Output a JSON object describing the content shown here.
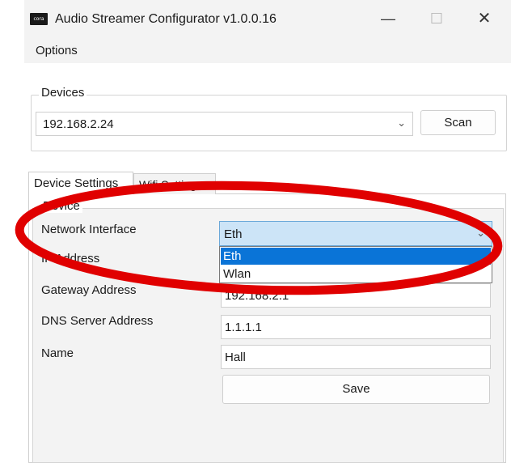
{
  "window": {
    "icon_text": "cora",
    "title": "Audio Streamer Configurator v1.0.0.16",
    "minimize_glyph": "—",
    "maximize_glyph": "☐",
    "close_glyph": "✕"
  },
  "menu": {
    "options_label": "Options"
  },
  "devices": {
    "legend": "Devices",
    "selected": "192.168.2.24",
    "chevron": "⌄",
    "scan_label": "Scan"
  },
  "tabs": [
    {
      "label": "Device Settings",
      "active": true
    },
    {
      "label": "Wifi Settings",
      "active": false
    }
  ],
  "device_settings": {
    "legend": "Device",
    "network_interface_label": "Network Interface",
    "network_interface_value": "Eth",
    "network_interface_options": [
      "Eth",
      "Wlan"
    ],
    "ip_address_label": "IP Address",
    "gateway_label": "Gateway Address",
    "gateway_value": "192.168.2.1",
    "dns_label": "DNS Server Address",
    "dns_value": "1.1.1.1",
    "name_label": "Name",
    "name_value": "Hall",
    "save_label": "Save"
  },
  "colors": {
    "annotation_ellipse": "#e00000",
    "dropdown_selected_bg": "#0a74d7",
    "combo_focus_bg": "#cce4f7"
  }
}
